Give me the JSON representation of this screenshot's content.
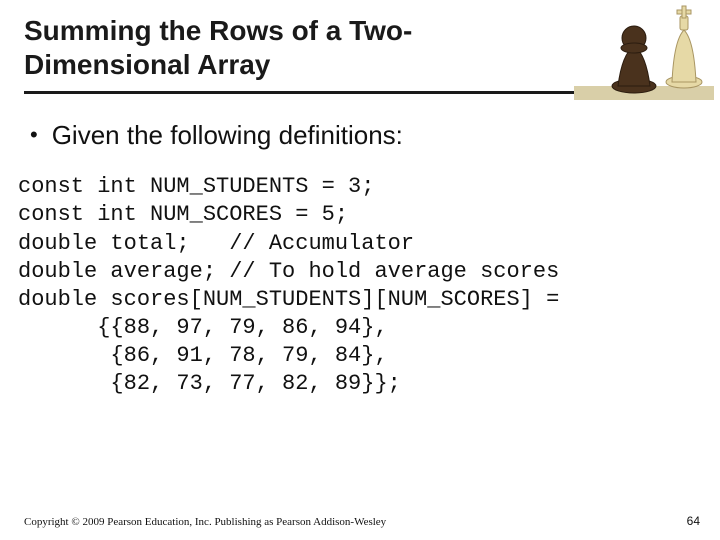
{
  "title": "Summing the Rows of a Two-Dimensional Array",
  "bullet": "Given the following definitions:",
  "code": "const int NUM_STUDENTS = 3;\nconst int NUM_SCORES = 5;\ndouble total;   // Accumulator\ndouble average; // To hold average scores\ndouble scores[NUM_STUDENTS][NUM_SCORES] =\n      {{88, 97, 79, 86, 94},\n       {86, 91, 78, 79, 84},\n       {82, 73, 77, 82, 89}};",
  "footer": "Copyright © 2009 Pearson Education, Inc. Publishing as Pearson Addison-Wesley",
  "page_num": "64"
}
